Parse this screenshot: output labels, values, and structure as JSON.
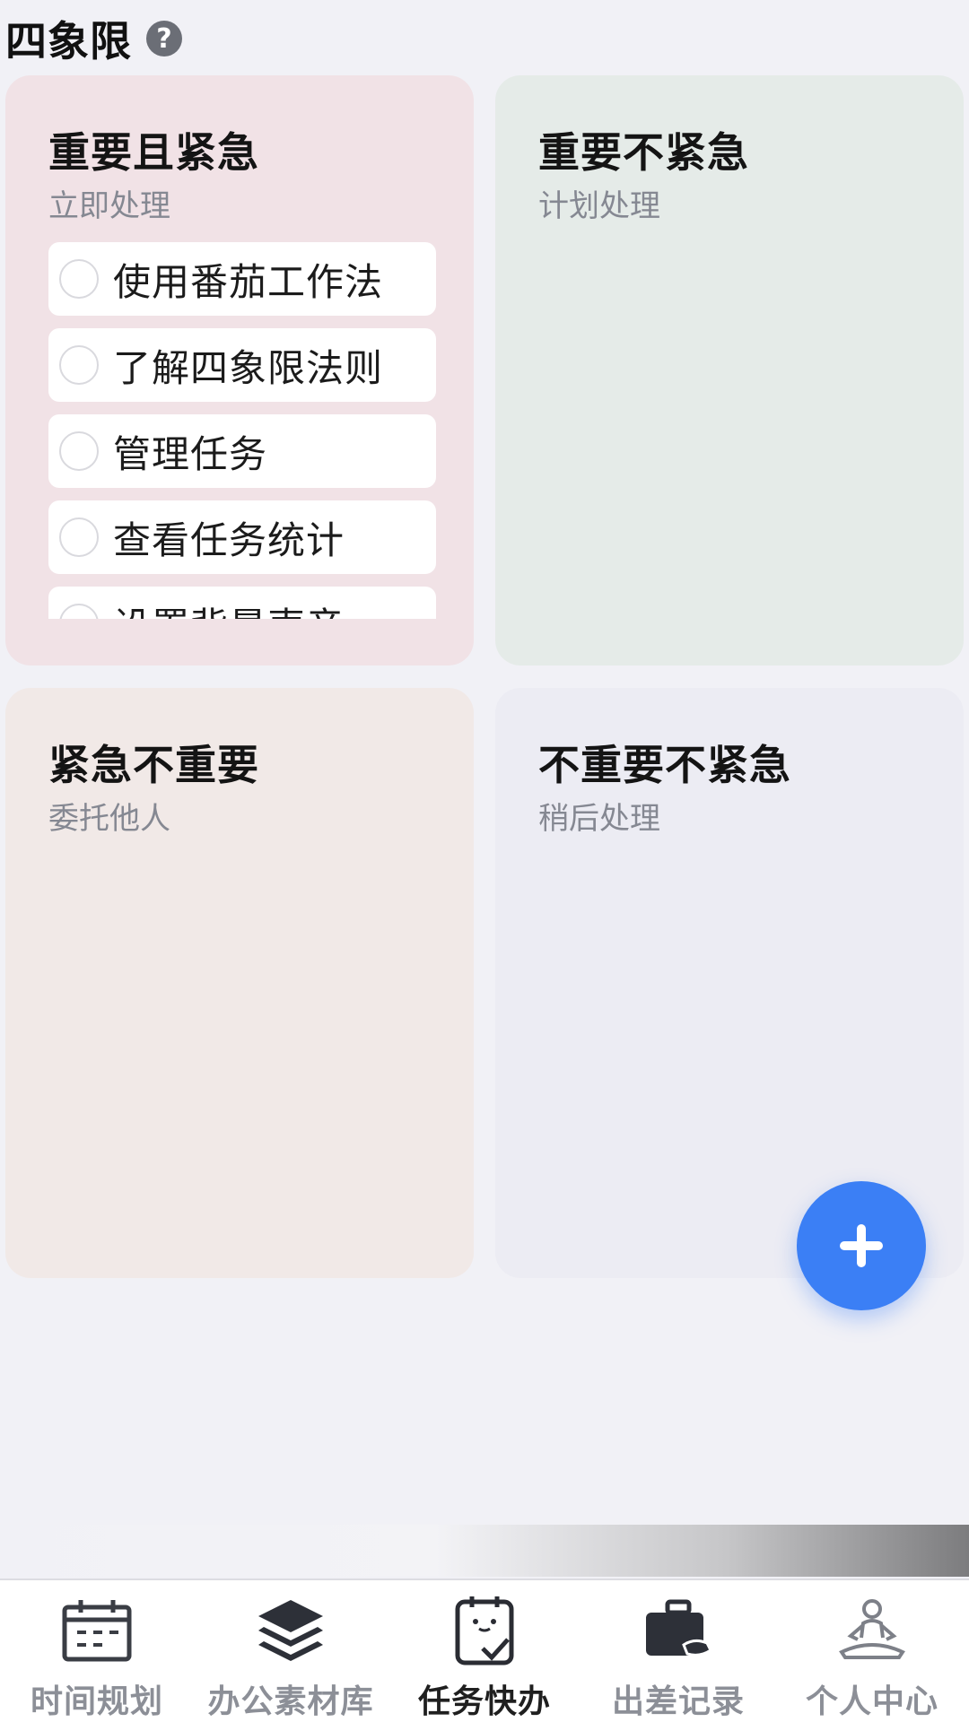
{
  "header": {
    "title": "四象限",
    "help_icon": "question-circle-icon"
  },
  "quadrants": [
    {
      "title": "重要且紧急",
      "subtitle": "立即处理",
      "color": "#f1e2e6",
      "tasks": [
        "使用番茄工作法",
        "了解四象限法则",
        "管理任务",
        "查看任务统计",
        "设置背景声音"
      ]
    },
    {
      "title": "重要不紧急",
      "subtitle": "计划处理",
      "color": "#e5ebe8",
      "tasks": []
    },
    {
      "title": "紧急不重要",
      "subtitle": "委托他人",
      "color": "#f1e9e7",
      "tasks": []
    },
    {
      "title": "不重要不紧急",
      "subtitle": "稍后处理",
      "color": "#ececf3",
      "tasks": []
    }
  ],
  "fab": {
    "icon": "plus-icon",
    "color": "#3b7ff5"
  },
  "tabbar": {
    "items": [
      {
        "label": "时间规划",
        "icon": "calendar-icon",
        "active": false
      },
      {
        "label": "办公素材库",
        "icon": "layers-icon",
        "active": false
      },
      {
        "label": "任务快办",
        "icon": "task-check-icon",
        "active": true
      },
      {
        "label": "出差记录",
        "icon": "briefcase-icon",
        "active": false
      },
      {
        "label": "个人中心",
        "icon": "meditation-person-icon",
        "active": false
      }
    ]
  }
}
